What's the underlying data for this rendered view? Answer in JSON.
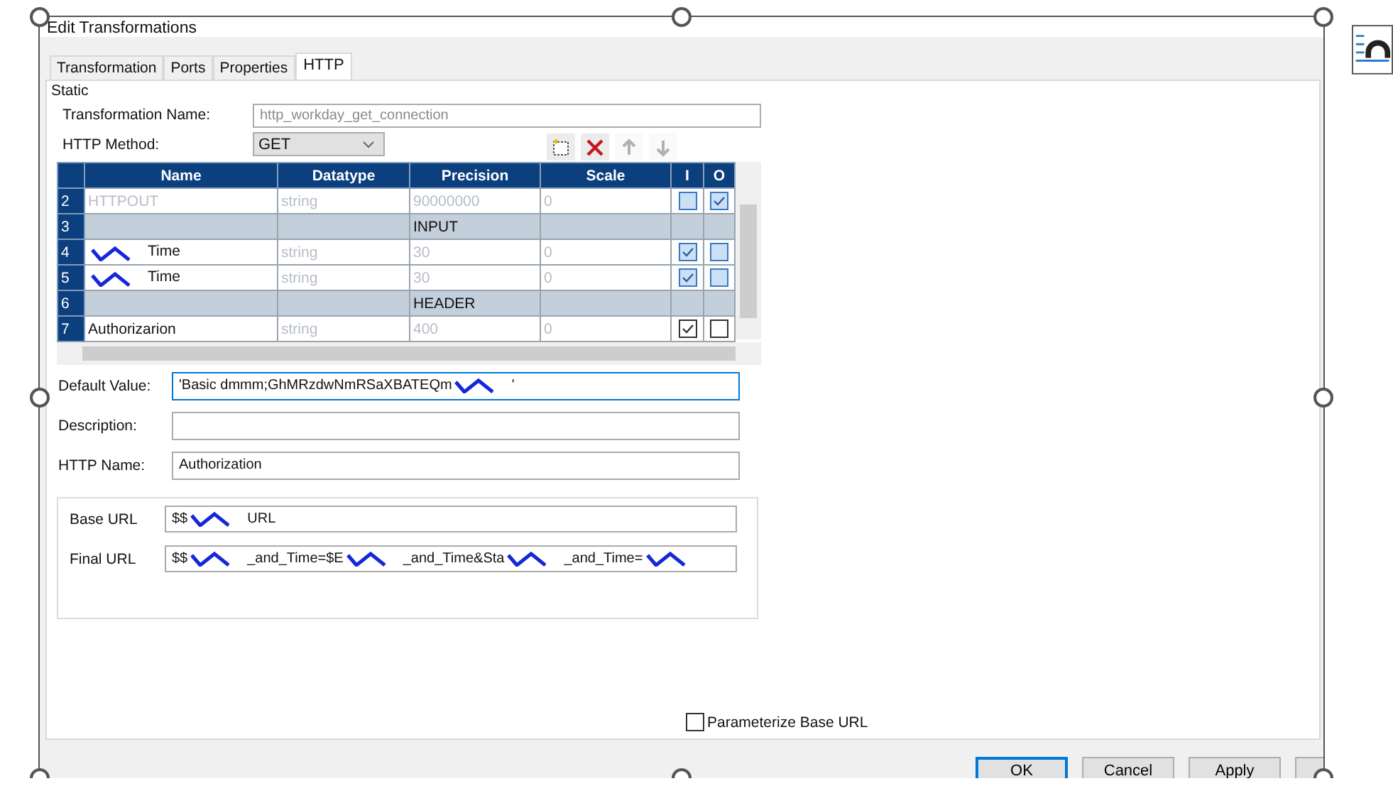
{
  "selection": {
    "selected": true
  },
  "window": {
    "title": "Edit Transformations"
  },
  "tabs": [
    {
      "label": "Transformation",
      "selected": false
    },
    {
      "label": "Ports",
      "selected": false
    },
    {
      "label": "Properties",
      "selected": false
    },
    {
      "label": "HTTP",
      "selected": true
    }
  ],
  "section_label": "Static",
  "transformation_name": {
    "label": "Transformation Name:",
    "value": "http_workday_get_connection",
    "disabled": true
  },
  "http_method": {
    "label": "HTTP Method:",
    "value": "GET"
  },
  "toolbar": [
    {
      "kind": "new",
      "disabled": false
    },
    {
      "kind": "delete",
      "disabled": false
    },
    {
      "kind": "up",
      "disabled": true
    },
    {
      "kind": "down",
      "disabled": true
    }
  ],
  "table": {
    "columns": [
      "Name",
      "Datatype",
      "Precision",
      "Scale",
      "I",
      "O"
    ],
    "rows": [
      {
        "kind": "port",
        "number": "2",
        "name": [
          {
            "kind": "text",
            "text": "HTTPOUT"
          }
        ],
        "datatype": "string",
        "precision": "90000000",
        "scale": "0",
        "input": false,
        "output": true,
        "disabled": true,
        "locked": true
      },
      {
        "kind": "group",
        "number": "3",
        "label": "INPUT"
      },
      {
        "kind": "port",
        "number": "4",
        "name": [
          {
            "kind": "scribble"
          },
          {
            "kind": "text",
            "text": "Time"
          }
        ],
        "datatype": "string",
        "precision": "30",
        "scale": "0",
        "input": true,
        "output": false,
        "disabled": false,
        "locked": true
      },
      {
        "kind": "port",
        "number": "5",
        "name": [
          {
            "kind": "scribble"
          },
          {
            "kind": "text",
            "text": "Time"
          }
        ],
        "datatype": "string",
        "precision": "30",
        "scale": "0",
        "input": true,
        "output": false,
        "disabled": false,
        "locked": true
      },
      {
        "kind": "group",
        "number": "6",
        "label": "HEADER"
      },
      {
        "kind": "port",
        "number": "7",
        "name": [
          {
            "kind": "text",
            "text": "Authorizarion"
          }
        ],
        "datatype": "string",
        "precision": "400",
        "scale": "0",
        "input": true,
        "output": false,
        "disabled": false,
        "locked": false
      }
    ]
  },
  "default_value": {
    "label": "Default Value:",
    "value": [
      {
        "kind": "text",
        "text": "'Basic dmmm;GhMRzdwNmRSaXBATEQm"
      },
      {
        "kind": "scribble"
      },
      {
        "kind": "text",
        "text": "'"
      }
    ],
    "focused": true
  },
  "description": {
    "label": "Description:"
  },
  "http_name": {
    "label": "HTTP Name:",
    "value": "Authorization"
  },
  "base_url": {
    "label": "Base URL",
    "value": [
      {
        "kind": "text",
        "text": "$$"
      },
      {
        "kind": "scribble"
      },
      {
        "kind": "text",
        "text": "URL"
      }
    ]
  },
  "final_url": {
    "label": "Final URL",
    "value": [
      {
        "kind": "text",
        "text": "$$"
      },
      {
        "kind": "scribble"
      },
      {
        "kind": "text",
        "text": "_and_Time=$E"
      },
      {
        "kind": "scribble"
      },
      {
        "kind": "text",
        "text": "_and_Time&Sta"
      },
      {
        "kind": "scribble"
      },
      {
        "kind": "text",
        "text": "_and_Time="
      },
      {
        "kind": "scribble"
      }
    ]
  },
  "parameterize_base_url": {
    "label": "Parameterize Base URL",
    "checked": false
  },
  "buttons": [
    {
      "kind": "text",
      "label": "OK",
      "default": true
    },
    {
      "kind": "text",
      "label": "Cancel",
      "default": false
    },
    {
      "kind": "text",
      "label": "Apply",
      "default": false
    },
    {
      "kind": "blank",
      "default": false
    }
  ]
}
